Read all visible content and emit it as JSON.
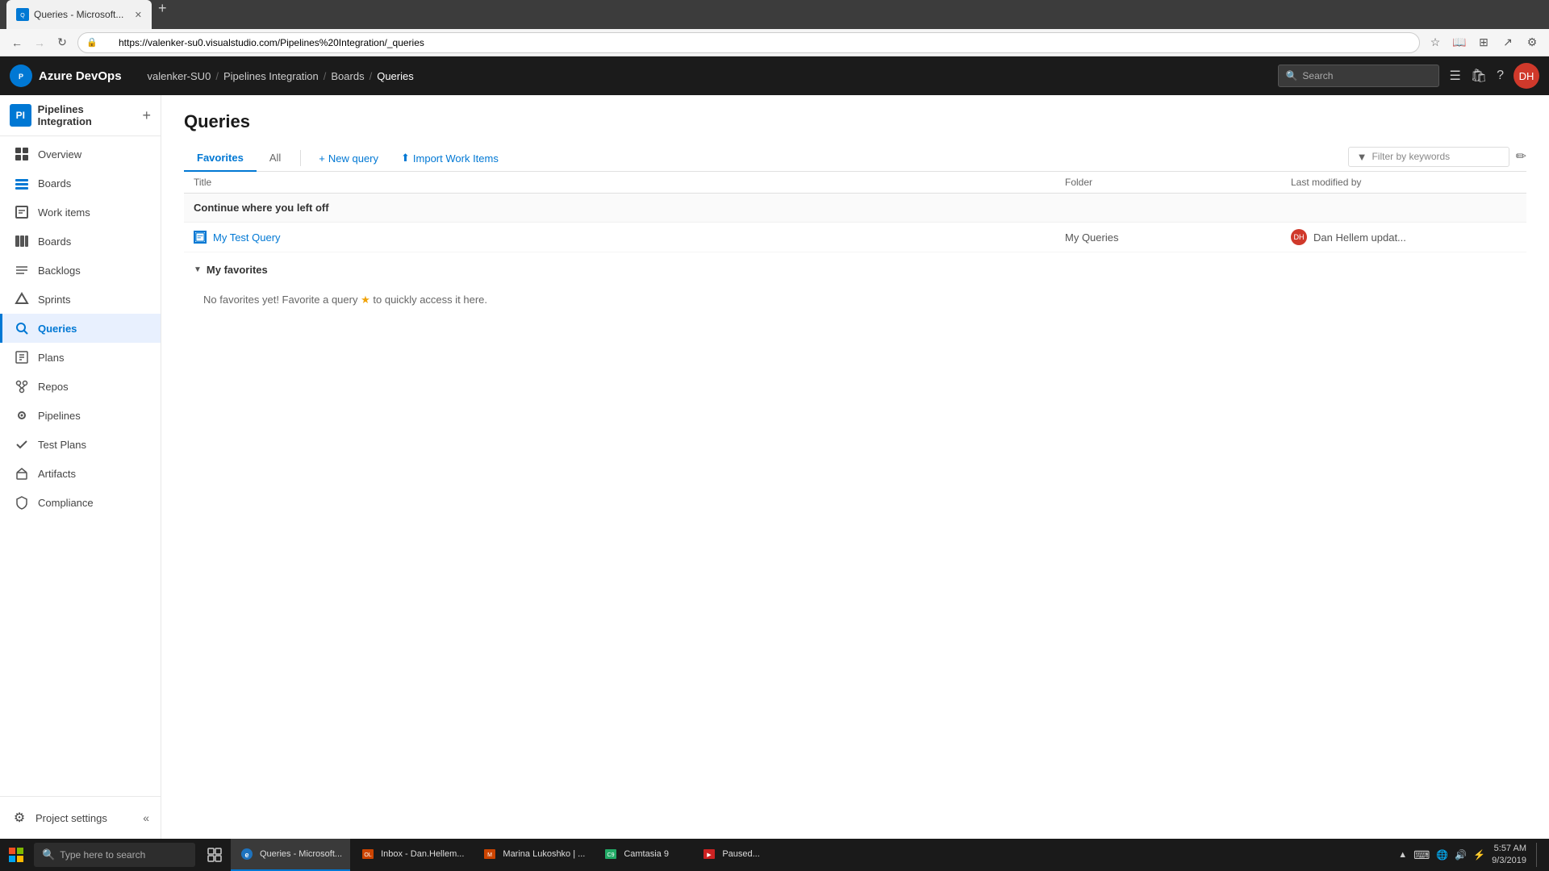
{
  "browser": {
    "tab_title": "Queries - Microsoft...",
    "tab_icon": "Q",
    "url": "https://valenker-su0.visualstudio.com/Pipelines%20Integration/_queries",
    "back_disabled": false,
    "forward_disabled": true
  },
  "top_nav": {
    "logo": "Azure DevOps",
    "logo_letter": "P",
    "breadcrumb": [
      {
        "label": "valenker-SU0",
        "link": true
      },
      {
        "label": "Pipelines Integration",
        "link": true
      },
      {
        "label": "Boards",
        "link": true
      },
      {
        "label": "Queries",
        "link": false
      }
    ],
    "search_placeholder": "Search",
    "avatar_initials": "DH"
  },
  "sidebar": {
    "project_name": "Pipelines Integration",
    "project_letter": "PI",
    "nav_items": [
      {
        "id": "overview",
        "label": "Overview",
        "icon": "⊞"
      },
      {
        "id": "boards",
        "label": "Boards",
        "icon": "⬛"
      },
      {
        "id": "work-items",
        "label": "Work items",
        "icon": "☰"
      },
      {
        "id": "boards2",
        "label": "Boards",
        "icon": "⬛"
      },
      {
        "id": "backlogs",
        "label": "Backlogs",
        "icon": "≡"
      },
      {
        "id": "sprints",
        "label": "Sprints",
        "icon": "⚡"
      },
      {
        "id": "queries",
        "label": "Queries",
        "icon": "⊞",
        "active": true
      },
      {
        "id": "plans",
        "label": "Plans",
        "icon": "📋"
      },
      {
        "id": "repos",
        "label": "Repos",
        "icon": "⎇"
      },
      {
        "id": "pipelines",
        "label": "Pipelines",
        "icon": "◎"
      },
      {
        "id": "test-plans",
        "label": "Test Plans",
        "icon": "✓"
      },
      {
        "id": "artifacts",
        "label": "Artifacts",
        "icon": "📦"
      },
      {
        "id": "compliance",
        "label": "Compliance",
        "icon": "🛡"
      }
    ],
    "settings_label": "Project settings",
    "collapse_label": "Collapse"
  },
  "page": {
    "title": "Queries",
    "tabs": [
      {
        "id": "favorites",
        "label": "Favorites",
        "active": true
      },
      {
        "id": "all",
        "label": "All",
        "active": false
      }
    ],
    "actions": [
      {
        "id": "new-query",
        "label": "New query",
        "icon": "+"
      },
      {
        "id": "import",
        "label": "Import Work Items",
        "icon": "⬆"
      }
    ],
    "filter_placeholder": "Filter by keywords",
    "table_headers": {
      "title": "Title",
      "folder": "Folder",
      "modified": "Last modified by"
    },
    "continue_section": {
      "heading": "Continue where you left off",
      "items": [
        {
          "title": "My Test Query",
          "folder": "My Queries",
          "modified_by": "Dan Hellem updat...",
          "avatar_initials": "DH"
        }
      ]
    },
    "favorites_section": {
      "heading": "My favorites",
      "empty_message": "No favorites yet! Favorite a query",
      "star": "★",
      "empty_suffix": " to quickly access it here."
    }
  },
  "taskbar": {
    "search_placeholder": "Type here to search",
    "apps": [
      {
        "id": "queries-ie",
        "label": "Queries - Microsoft...",
        "active": true,
        "color": "#1e73be"
      },
      {
        "id": "inbox",
        "label": "Inbox - Dan.Hellem...",
        "active": false,
        "color": "#cc4400"
      },
      {
        "id": "marina",
        "label": "Marina Lukoshko | ...",
        "active": false,
        "color": "#cc4400"
      },
      {
        "id": "camtasia",
        "label": "Camtasia 9",
        "active": false,
        "color": "#22aa66"
      },
      {
        "id": "paused",
        "label": "Paused...",
        "active": false,
        "color": "#cc2222"
      }
    ],
    "time": "5:57 AM",
    "date": "9/3/2019"
  }
}
